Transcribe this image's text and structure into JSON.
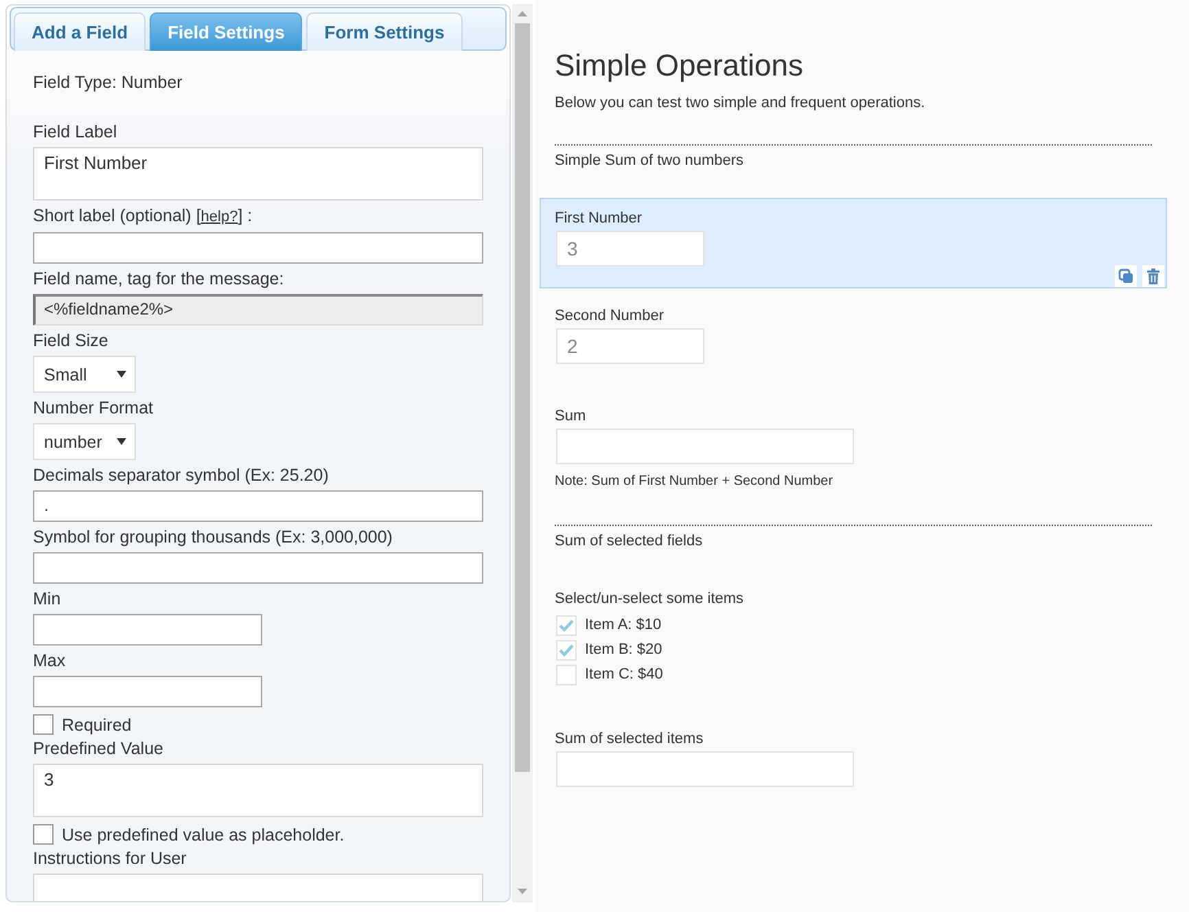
{
  "builder": {
    "tabs": [
      {
        "label": "Add a Field",
        "selected": false
      },
      {
        "label": "Field Settings",
        "selected": true
      },
      {
        "label": "Form Settings",
        "selected": false
      }
    ],
    "field_type": "Field Type: Number",
    "settings": [
      {
        "kind": "textarea",
        "label": "Field Label",
        "value": "First Number"
      },
      {
        "kind": "text",
        "label": "Short label (optional) [",
        "link": "help?",
        "label_end": "] :"
      },
      {
        "kind": "readonly",
        "label": "Field name, tag for the message:",
        "value": "<%fieldname2%>"
      },
      {
        "kind": "select",
        "label": "Field Size",
        "value": "Small"
      },
      {
        "kind": "select",
        "label": "Number Format",
        "value": "number"
      },
      {
        "kind": "text",
        "label": "Decimals separator symbol (Ex: 25.20)",
        "value": "."
      },
      {
        "kind": "text",
        "label": "Symbol for grouping thousands (Ex: 3,000,000)"
      },
      {
        "kind": "short_text",
        "label": "Min"
      },
      {
        "kind": "short_text",
        "label": "Max"
      },
      {
        "kind": "checkbox",
        "label": "Required",
        "checked": false
      },
      {
        "kind": "textarea",
        "label": "Predefined Value",
        "value": "3"
      },
      {
        "kind": "checkbox",
        "label": "Use predefined value as placeholder.",
        "checked": false
      },
      {
        "kind": "textarea",
        "label": "Instructions for User"
      }
    ]
  },
  "form": {
    "title": "Simple Operations",
    "description": "Below you can test two simple and frequent operations.",
    "items": [
      {
        "kind": "section",
        "title": "Simple Sum of two numbers",
        "selected": false
      },
      {
        "kind": "number",
        "label": "First Number",
        "value": "3",
        "selected": true
      },
      {
        "kind": "number",
        "label": "Second Number",
        "value": "2",
        "selected": false
      },
      {
        "kind": "calculated",
        "label": "Sum",
        "note": "Note: Sum of First Number + Second Number",
        "selected": false
      },
      {
        "kind": "section",
        "title": "Sum of selected fields",
        "selected": false
      },
      {
        "kind": "checkboxes",
        "label": "Select/un-select some items",
        "options": [
          {
            "label": "Item A: $10",
            "checked": true
          },
          {
            "label": "Item B: $20",
            "checked": true
          },
          {
            "label": "Item C: $40",
            "checked": false
          }
        ],
        "selected": false
      },
      {
        "kind": "calculated",
        "label": "Sum of selected items",
        "selected": false
      }
    ]
  }
}
